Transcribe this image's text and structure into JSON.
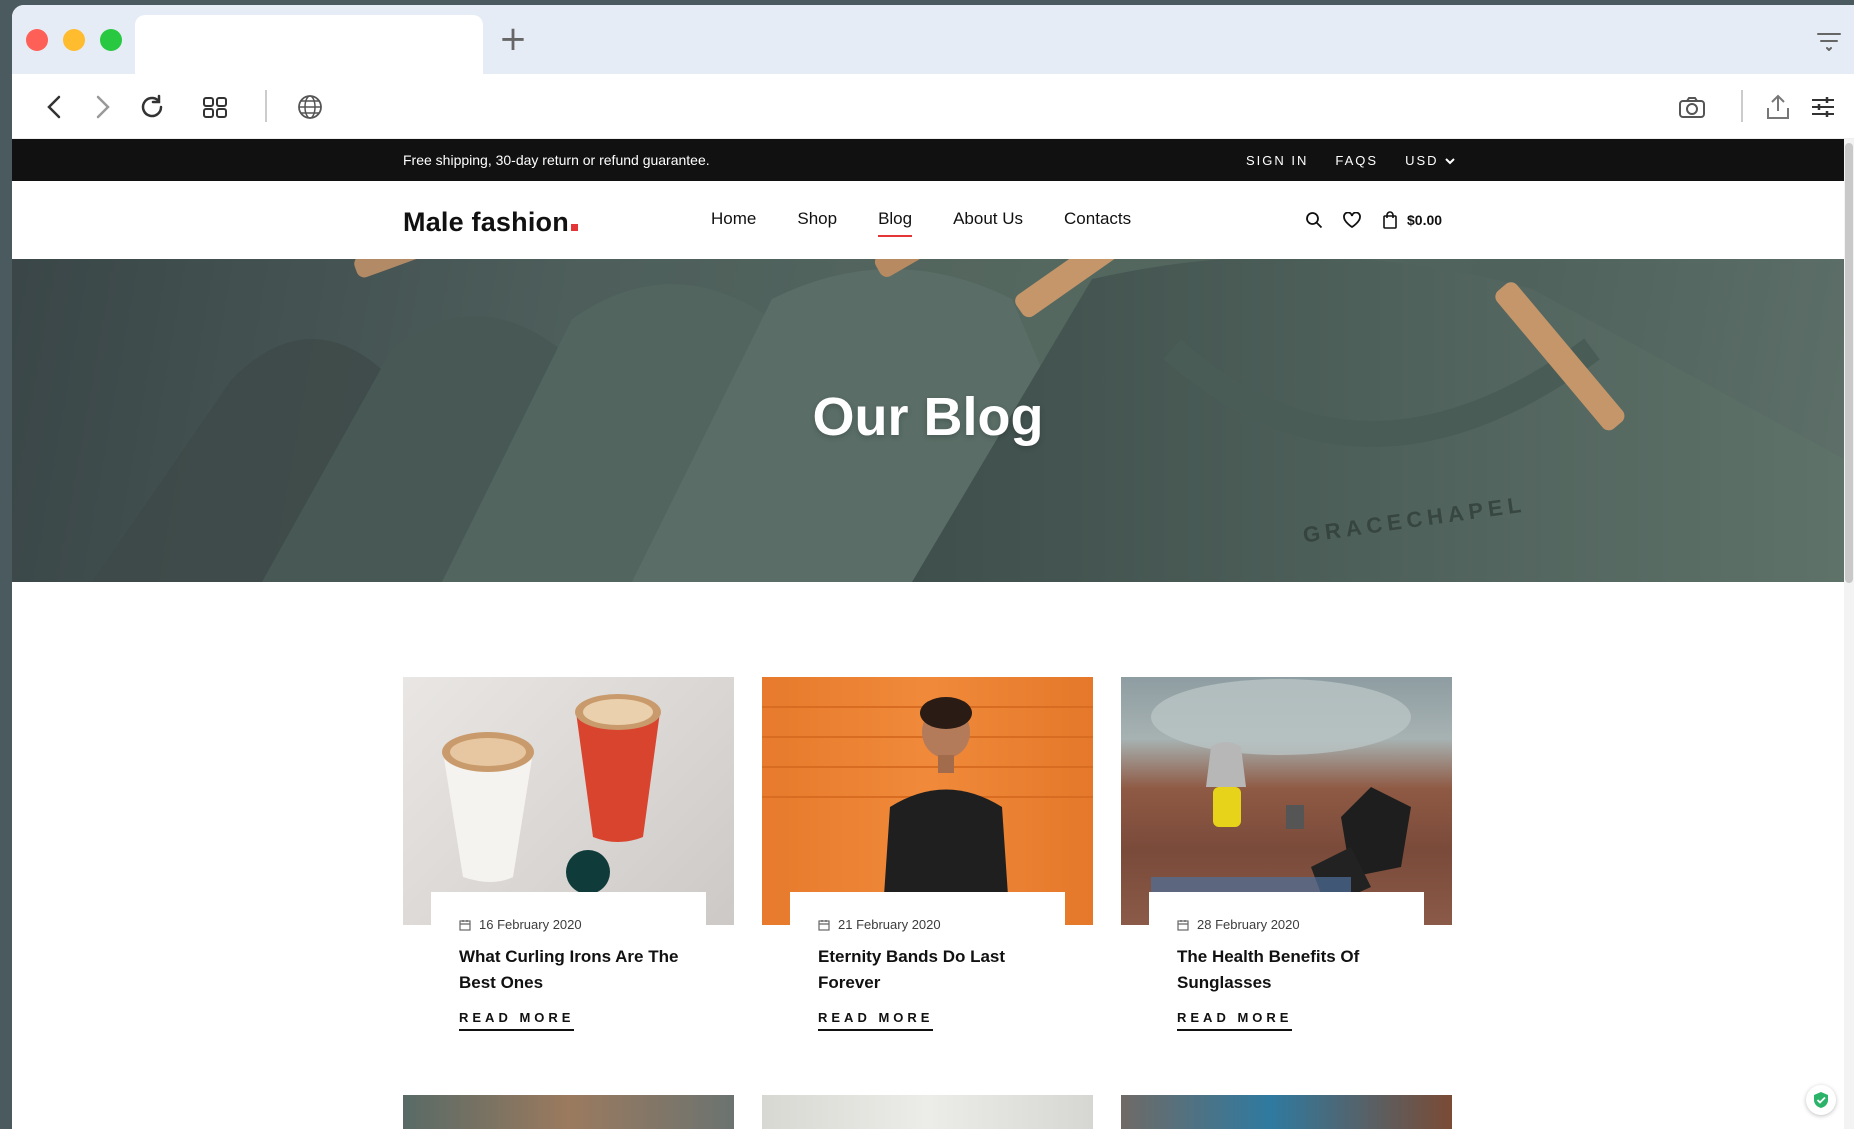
{
  "browser": {
    "new_tab_glyph": "+",
    "icons": [
      "back-icon",
      "forward-icon",
      "reload-icon",
      "grid-icon",
      "globe-icon",
      "camera-icon",
      "share-icon",
      "settings-icon",
      "tab-menu-icon"
    ]
  },
  "topbar": {
    "promo": "Free shipping, 30-day return or refund guarantee.",
    "sign_in": "SIGN IN",
    "faqs": "FAQS",
    "currency": "USD"
  },
  "header": {
    "logo": "Male fashion",
    "nav": [
      "Home",
      "Shop",
      "Blog",
      "About Us",
      "Contacts"
    ],
    "active_nav": "Blog",
    "cart_price": "$0.00"
  },
  "hero": {
    "title": "Our Blog",
    "print": "GRACECHAPEL"
  },
  "posts": [
    {
      "date": "16 February 2020",
      "title": "What Curling Irons Are The Best Ones",
      "read_more": "READ MORE"
    },
    {
      "date": "21 February 2020",
      "title": "Eternity Bands Do Last Forever",
      "read_more": "READ MORE"
    },
    {
      "date": "28 February 2020",
      "title": "The Health Benefits Of Sunglasses",
      "read_more": "READ MORE"
    }
  ],
  "colors": {
    "accent": "#e53637",
    "topbar_bg": "#111111"
  }
}
